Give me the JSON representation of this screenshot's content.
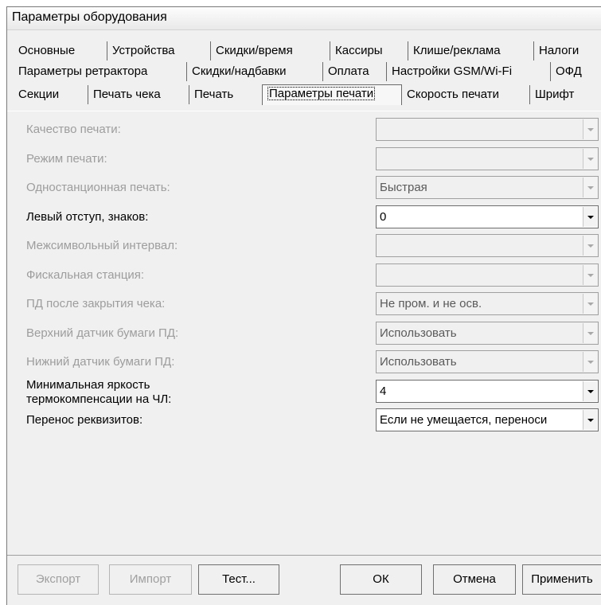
{
  "window": {
    "title": "Параметры оборудования"
  },
  "tabs": {
    "row1": [
      "Основные",
      "Устройства",
      "Скидки/время",
      "Кассиры",
      "Клише/реклама",
      "Налоги"
    ],
    "row2": [
      "Параметры ретрактора",
      "Скидки/надбавки",
      "Оплата",
      "Настройки GSM/Wi-Fi",
      "ОФД"
    ],
    "row3": [
      "Секции",
      "Печать чека",
      "Печать",
      "Параметры печати",
      "Скорость печати",
      "Шрифт"
    ]
  },
  "fields": [
    {
      "label": "Качество печати:",
      "value": ""
    },
    {
      "label": "Режим печати:",
      "value": ""
    },
    {
      "label": "Одностанционная печать:",
      "value": "Быстрая"
    },
    {
      "label": "Левый отступ, знаков:",
      "value": "0"
    },
    {
      "label": "Межсимвольный интервал:",
      "value": ""
    },
    {
      "label": "Фискальная станция:",
      "value": ""
    },
    {
      "label": "ПД после закрытия чека:",
      "value": "Не пром. и не осв."
    },
    {
      "label": "Верхний датчик бумаги ПД:",
      "value": "Использовать"
    },
    {
      "label": "Нижний датчик бумаги ПД:",
      "value": "Использовать"
    },
    {
      "label_line1": "Минимальная яркость",
      "label_line2": "термокомпенсации на ЧЛ:",
      "value": "4"
    },
    {
      "label": "Перенос реквизитов:",
      "value": "Если не умещается, переноси"
    }
  ],
  "buttons": {
    "export": "Экспорт",
    "import": "Импорт",
    "test": "Тест...",
    "ok": "ОК",
    "cancel": "Отмена",
    "apply": "Применить"
  }
}
